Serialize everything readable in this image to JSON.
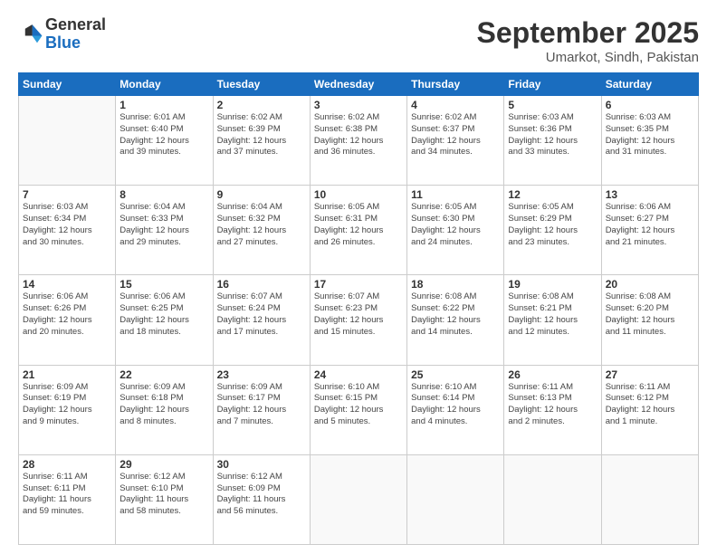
{
  "logo": {
    "general": "General",
    "blue": "Blue"
  },
  "title": "September 2025",
  "subtitle": "Umarkot, Sindh, Pakistan",
  "days_header": [
    "Sunday",
    "Monday",
    "Tuesday",
    "Wednesday",
    "Thursday",
    "Friday",
    "Saturday"
  ],
  "weeks": [
    [
      {
        "day": "",
        "info": ""
      },
      {
        "day": "1",
        "info": "Sunrise: 6:01 AM\nSunset: 6:40 PM\nDaylight: 12 hours\nand 39 minutes."
      },
      {
        "day": "2",
        "info": "Sunrise: 6:02 AM\nSunset: 6:39 PM\nDaylight: 12 hours\nand 37 minutes."
      },
      {
        "day": "3",
        "info": "Sunrise: 6:02 AM\nSunset: 6:38 PM\nDaylight: 12 hours\nand 36 minutes."
      },
      {
        "day": "4",
        "info": "Sunrise: 6:02 AM\nSunset: 6:37 PM\nDaylight: 12 hours\nand 34 minutes."
      },
      {
        "day": "5",
        "info": "Sunrise: 6:03 AM\nSunset: 6:36 PM\nDaylight: 12 hours\nand 33 minutes."
      },
      {
        "day": "6",
        "info": "Sunrise: 6:03 AM\nSunset: 6:35 PM\nDaylight: 12 hours\nand 31 minutes."
      }
    ],
    [
      {
        "day": "7",
        "info": "Sunrise: 6:03 AM\nSunset: 6:34 PM\nDaylight: 12 hours\nand 30 minutes."
      },
      {
        "day": "8",
        "info": "Sunrise: 6:04 AM\nSunset: 6:33 PM\nDaylight: 12 hours\nand 29 minutes."
      },
      {
        "day": "9",
        "info": "Sunrise: 6:04 AM\nSunset: 6:32 PM\nDaylight: 12 hours\nand 27 minutes."
      },
      {
        "day": "10",
        "info": "Sunrise: 6:05 AM\nSunset: 6:31 PM\nDaylight: 12 hours\nand 26 minutes."
      },
      {
        "day": "11",
        "info": "Sunrise: 6:05 AM\nSunset: 6:30 PM\nDaylight: 12 hours\nand 24 minutes."
      },
      {
        "day": "12",
        "info": "Sunrise: 6:05 AM\nSunset: 6:29 PM\nDaylight: 12 hours\nand 23 minutes."
      },
      {
        "day": "13",
        "info": "Sunrise: 6:06 AM\nSunset: 6:27 PM\nDaylight: 12 hours\nand 21 minutes."
      }
    ],
    [
      {
        "day": "14",
        "info": "Sunrise: 6:06 AM\nSunset: 6:26 PM\nDaylight: 12 hours\nand 20 minutes."
      },
      {
        "day": "15",
        "info": "Sunrise: 6:06 AM\nSunset: 6:25 PM\nDaylight: 12 hours\nand 18 minutes."
      },
      {
        "day": "16",
        "info": "Sunrise: 6:07 AM\nSunset: 6:24 PM\nDaylight: 12 hours\nand 17 minutes."
      },
      {
        "day": "17",
        "info": "Sunrise: 6:07 AM\nSunset: 6:23 PM\nDaylight: 12 hours\nand 15 minutes."
      },
      {
        "day": "18",
        "info": "Sunrise: 6:08 AM\nSunset: 6:22 PM\nDaylight: 12 hours\nand 14 minutes."
      },
      {
        "day": "19",
        "info": "Sunrise: 6:08 AM\nSunset: 6:21 PM\nDaylight: 12 hours\nand 12 minutes."
      },
      {
        "day": "20",
        "info": "Sunrise: 6:08 AM\nSunset: 6:20 PM\nDaylight: 12 hours\nand 11 minutes."
      }
    ],
    [
      {
        "day": "21",
        "info": "Sunrise: 6:09 AM\nSunset: 6:19 PM\nDaylight: 12 hours\nand 9 minutes."
      },
      {
        "day": "22",
        "info": "Sunrise: 6:09 AM\nSunset: 6:18 PM\nDaylight: 12 hours\nand 8 minutes."
      },
      {
        "day": "23",
        "info": "Sunrise: 6:09 AM\nSunset: 6:17 PM\nDaylight: 12 hours\nand 7 minutes."
      },
      {
        "day": "24",
        "info": "Sunrise: 6:10 AM\nSunset: 6:15 PM\nDaylight: 12 hours\nand 5 minutes."
      },
      {
        "day": "25",
        "info": "Sunrise: 6:10 AM\nSunset: 6:14 PM\nDaylight: 12 hours\nand 4 minutes."
      },
      {
        "day": "26",
        "info": "Sunrise: 6:11 AM\nSunset: 6:13 PM\nDaylight: 12 hours\nand 2 minutes."
      },
      {
        "day": "27",
        "info": "Sunrise: 6:11 AM\nSunset: 6:12 PM\nDaylight: 12 hours\nand 1 minute."
      }
    ],
    [
      {
        "day": "28",
        "info": "Sunrise: 6:11 AM\nSunset: 6:11 PM\nDaylight: 11 hours\nand 59 minutes."
      },
      {
        "day": "29",
        "info": "Sunrise: 6:12 AM\nSunset: 6:10 PM\nDaylight: 11 hours\nand 58 minutes."
      },
      {
        "day": "30",
        "info": "Sunrise: 6:12 AM\nSunset: 6:09 PM\nDaylight: 11 hours\nand 56 minutes."
      },
      {
        "day": "",
        "info": ""
      },
      {
        "day": "",
        "info": ""
      },
      {
        "day": "",
        "info": ""
      },
      {
        "day": "",
        "info": ""
      }
    ]
  ]
}
